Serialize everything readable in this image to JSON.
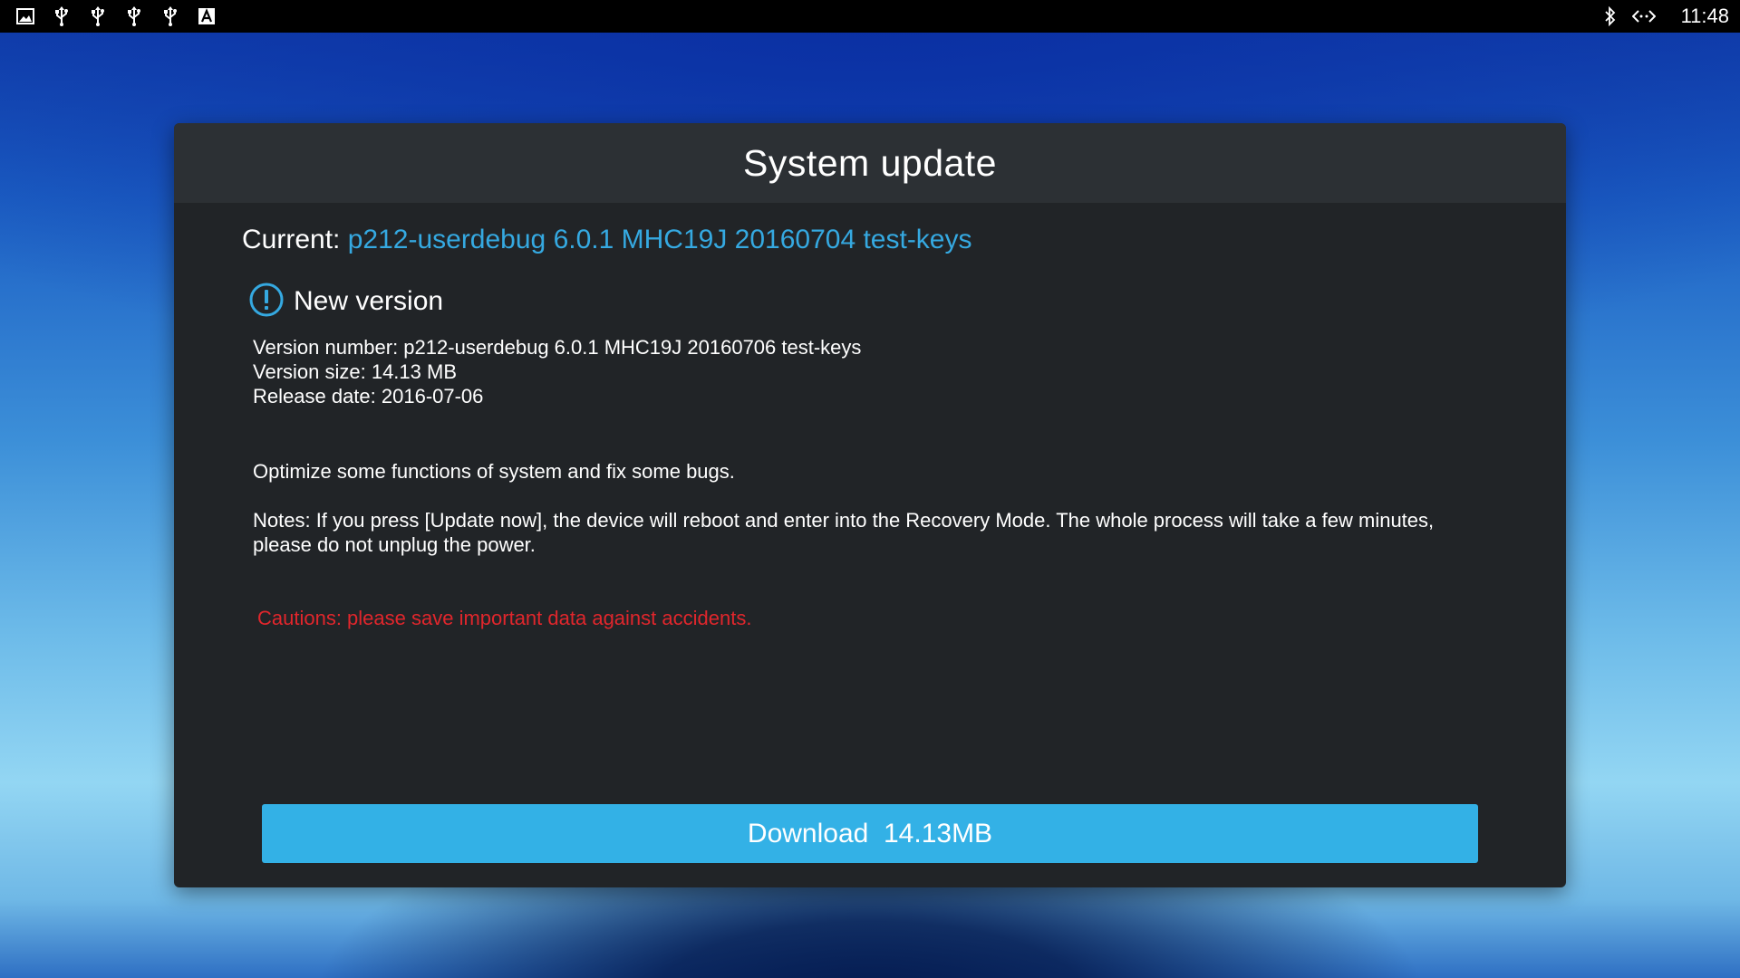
{
  "status_bar": {
    "left_icons": [
      "image-icon",
      "usb-icon",
      "usb-icon",
      "usb-icon",
      "usb-icon",
      "keyboard-icon"
    ],
    "right_icons": [
      "bluetooth-icon",
      "ethernet-icon"
    ],
    "time": "11:48"
  },
  "dialog": {
    "title": "System update",
    "current_label": "Current: ",
    "current_value": "p212-userdebug 6.0.1 MHC19J 20160704 test-keys",
    "new_version_label": "New version",
    "version_number": "Version number: p212-userdebug 6.0.1 MHC19J 20160706 test-keys",
    "version_size": "Version size: 14.13 MB",
    "release_date": "Release date: 2016-07-06",
    "description": "Optimize some functions of system and fix some bugs.",
    "notes": "Notes: If you press [Update now], the device will reboot and enter into the Recovery Mode. The whole process will take a few minutes, please do not unplug the power.",
    "cautions": "Cautions: please save important data against accidents.",
    "download_button": "Download  14.13MB"
  },
  "colors": {
    "accent_blue": "#35a9e1",
    "button_blue": "#33b1e6",
    "caution_red": "#e0262c",
    "dialog_bg": "#212427",
    "header_bg": "#2c3034"
  }
}
